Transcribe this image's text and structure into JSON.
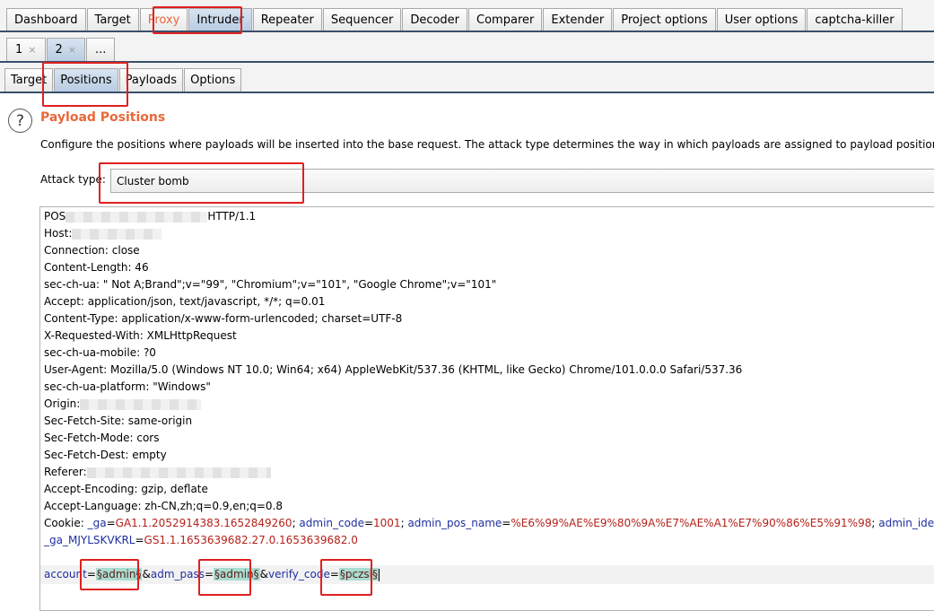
{
  "main_tabs": [
    "Dashboard",
    "Target",
    "Proxy",
    "Intruder",
    "Repeater",
    "Sequencer",
    "Decoder",
    "Comparer",
    "Extender",
    "Project options",
    "User options",
    "captcha-killer"
  ],
  "sub_tabs": [
    {
      "label": "1",
      "close": "×"
    },
    {
      "label": "2",
      "close": "×"
    },
    {
      "label": "..."
    }
  ],
  "intruder_tabs": [
    "Target",
    "Positions",
    "Payloads",
    "Options"
  ],
  "help_icon": "?",
  "section": {
    "title": "Payload Positions",
    "description": "Configure the positions where payloads will be inserted into the base request. The attack type determines the way in which payloads are assigned to payload positions - see"
  },
  "attack": {
    "label": "Attack type:",
    "value": "Cluster bomb"
  },
  "request": {
    "line1_prefix": "POS",
    "line1_suffix": "HTTP/1.1",
    "host": "Host:",
    "headers": [
      "Connection: close",
      "Content-Length: 46",
      "sec-ch-ua: \" Not A;Brand\";v=\"99\", \"Chromium\";v=\"101\", \"Google Chrome\";v=\"101\"",
      "Accept: application/json, text/javascript, */*; q=0.01",
      "Content-Type: application/x-www-form-urlencoded; charset=UTF-8",
      "X-Requested-With: XMLHttpRequest",
      "sec-ch-ua-mobile: ?0",
      "User-Agent: Mozilla/5.0 (Windows NT 10.0; Win64; x64) AppleWebKit/537.36 (KHTML, like Gecko) Chrome/101.0.0.0 Safari/537.36",
      "sec-ch-ua-platform: \"Windows\""
    ],
    "origin": "Origin:",
    "headers2": [
      "Sec-Fetch-Site: same-origin",
      "Sec-Fetch-Mode: cors",
      "Sec-Fetch-Dest: empty"
    ],
    "referer": "Referer:",
    "headers3": [
      "Accept-Encoding: gzip, deflate",
      "Accept-Language: zh-CN,zh;q=0.9,en;q=0.8"
    ],
    "cookie_label": "Cookie: ",
    "cookie1_name": "_ga",
    "cookie1_val": "GA1.1.2052914383.1652849260",
    "cookie2_name": "admin_code",
    "cookie2_val": "1001",
    "cookie3_name": "admin_pos_name",
    "cookie3_val": "%E6%99%AE%E9%80%9A%E7%AE%A1%E7%90%86%E5%91%98",
    "cookie4_name": "admin_identity",
    "cookie5_name": "_ga_MJYLSKVKRL",
    "cookie5_val": "GS1.1.1653639682.27.0.1653639682.0"
  },
  "body": {
    "p1_name": "account",
    "p1_val": "§admin§",
    "p2_name": "adm_pass",
    "p2_val": "§admin§",
    "p3_name": "verify_code",
    "p3_val": "§pczsl§"
  }
}
